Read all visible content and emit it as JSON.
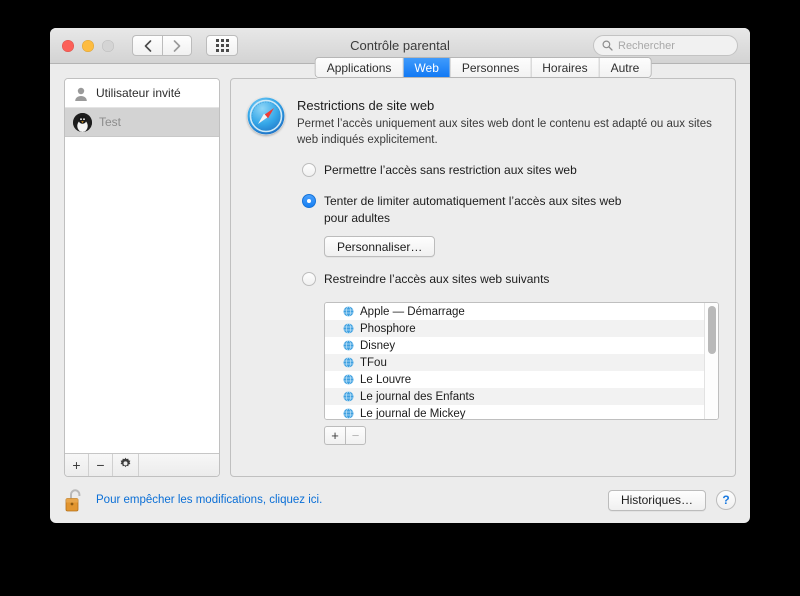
{
  "window": {
    "title": "Contrôle parental",
    "traffic_lights": [
      "close",
      "minimize",
      "zoom"
    ]
  },
  "toolbar": {
    "back_icon": "chevron-left-icon",
    "forward_icon": "chevron-right-icon",
    "grid_icon": "show-all-grid-icon",
    "search": {
      "placeholder": "Rechercher",
      "value": "",
      "icon": "search-icon"
    }
  },
  "sidebar": {
    "users": [
      {
        "label": "Utilisateur invité",
        "icon": "guest-user-icon",
        "selected": false
      },
      {
        "label": "Test",
        "icon": "penguin-avatar",
        "selected": true
      }
    ],
    "footer": {
      "add_label": "+",
      "remove_label": "−",
      "gear_icon": "gear-icon"
    }
  },
  "tabs": [
    {
      "label": "Applications",
      "active": false
    },
    {
      "label": "Web",
      "active": true
    },
    {
      "label": "Personnes",
      "active": false
    },
    {
      "label": "Horaires",
      "active": false
    },
    {
      "label": "Autre",
      "active": false
    }
  ],
  "main": {
    "icon": "safari-compass-icon",
    "title": "Restrictions de site web",
    "description": "Permet l’accès uniquement aux sites web dont le contenu est adapté ou aux sites web indiqués explicitement.",
    "radio_options": [
      {
        "label": "Permettre l’accès sans restriction aux sites web",
        "selected": false
      },
      {
        "label": "Tenter de limiter automatiquement l’accès aux sites web pour adultes",
        "selected": true
      },
      {
        "label": "Restreindre l’accès aux sites web suivants",
        "selected": false
      }
    ],
    "customize_button": "Personnaliser…",
    "website_list": [
      "Apple — Démarrage",
      "Phosphore",
      "Disney",
      "TFou",
      "Le Louvre",
      "Le journal des Enfants",
      "Le journal de Mickey"
    ],
    "list_buttons": {
      "add": "+",
      "remove": "−"
    }
  },
  "footer": {
    "lock_icon": "unlocked-padlock-icon",
    "lock_text": "Pour empêcher les modifications, cliquez ici.",
    "history_button": "Historiques…",
    "help_button": "?"
  },
  "colors": {
    "accent_blue": "#1279f4",
    "link_blue": "#0b6fd6",
    "lock_gold": "#e0922f",
    "window_bg": "#ececec"
  }
}
